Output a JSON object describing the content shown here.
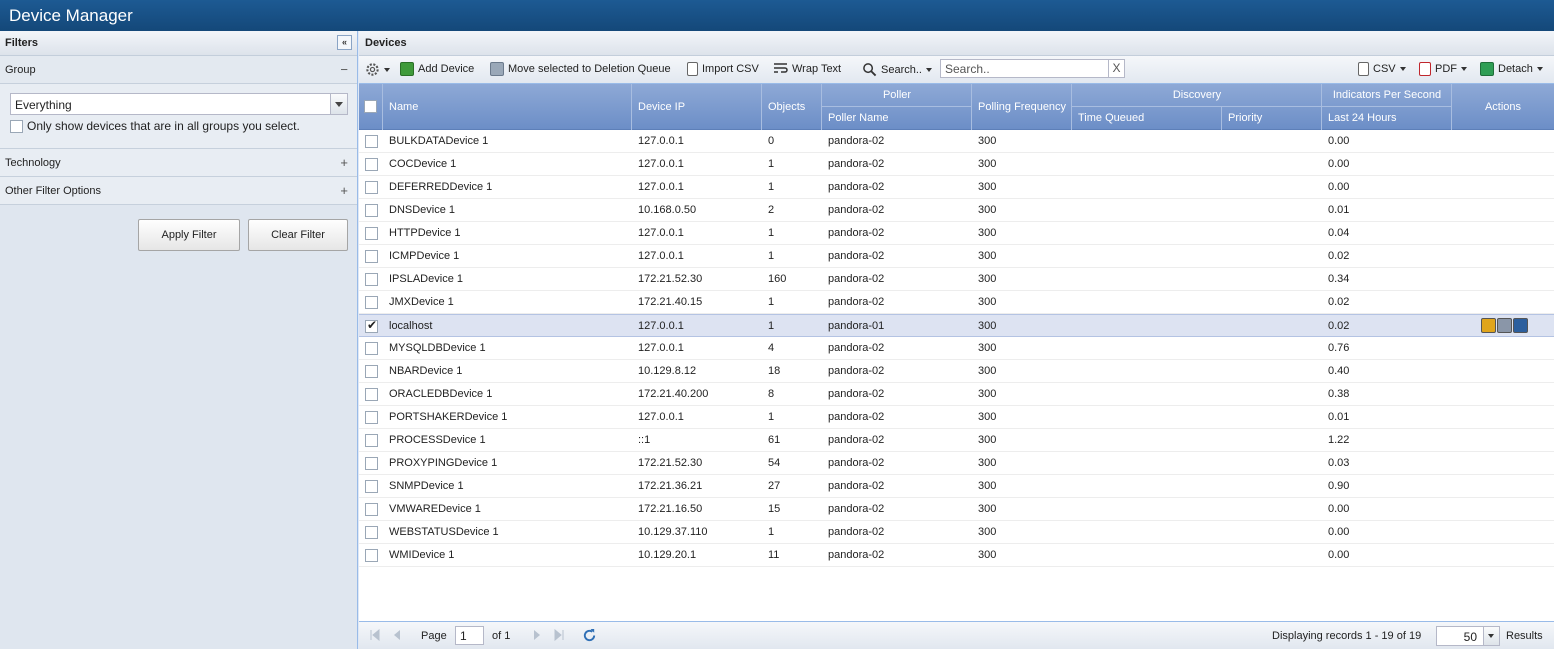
{
  "app": {
    "title": "Device Manager"
  },
  "filters": {
    "title": "Filters",
    "collapse_glyph": "«",
    "group": {
      "label": "Group",
      "toggle": "−",
      "value": "Everything",
      "only_all_label": "Only show devices that are in all groups you select."
    },
    "technology": {
      "label": "Technology",
      "toggle": "+"
    },
    "other": {
      "label": "Other Filter Options",
      "toggle": "+"
    },
    "apply_label": "Apply Filter",
    "clear_label": "Clear Filter"
  },
  "devices": {
    "title": "Devices",
    "toolbar": {
      "add_device": "Add Device",
      "move_deletion": "Move selected to Deletion Queue",
      "import_csv": "Import CSV",
      "wrap_text": "Wrap Text",
      "search_menu": "Search..",
      "search_placeholder": "Search..",
      "search_clear": "X",
      "csv": "CSV",
      "pdf": "PDF",
      "detach": "Detach"
    },
    "columns": {
      "name": "Name",
      "device_ip": "Device IP",
      "objects": "Objects",
      "poller": "Poller",
      "poller_name": "Poller Name",
      "polling_frequency": "Polling Frequency",
      "discovery": "Discovery",
      "time_queued": "Time Queued",
      "priority": "Priority",
      "ips": "Indicators Per Second",
      "last24": "Last 24 Hours",
      "actions": "Actions"
    },
    "rows": [
      {
        "name": "BULKDATADevice 1",
        "ip": "127.0.0.1",
        "objects": "0",
        "poller": "pandora-02",
        "freq": "300",
        "ips": "0.00",
        "selected": false
      },
      {
        "name": "COCDevice 1",
        "ip": "127.0.0.1",
        "objects": "1",
        "poller": "pandora-02",
        "freq": "300",
        "ips": "0.00",
        "selected": false
      },
      {
        "name": "DEFERREDDevice 1",
        "ip": "127.0.0.1",
        "objects": "1",
        "poller": "pandora-02",
        "freq": "300",
        "ips": "0.00",
        "selected": false
      },
      {
        "name": "DNSDevice 1",
        "ip": "10.168.0.50",
        "objects": "2",
        "poller": "pandora-02",
        "freq": "300",
        "ips": "0.01",
        "selected": false
      },
      {
        "name": "HTTPDevice 1",
        "ip": "127.0.0.1",
        "objects": "1",
        "poller": "pandora-02",
        "freq": "300",
        "ips": "0.04",
        "selected": false
      },
      {
        "name": "ICMPDevice 1",
        "ip": "127.0.0.1",
        "objects": "1",
        "poller": "pandora-02",
        "freq": "300",
        "ips": "0.02",
        "selected": false
      },
      {
        "name": "IPSLADevice 1",
        "ip": "172.21.52.30",
        "objects": "160",
        "poller": "pandora-02",
        "freq": "300",
        "ips": "0.34",
        "selected": false
      },
      {
        "name": "JMXDevice 1",
        "ip": "172.21.40.15",
        "objects": "1",
        "poller": "pandora-02",
        "freq": "300",
        "ips": "0.02",
        "selected": false
      },
      {
        "name": "localhost",
        "ip": "127.0.0.1",
        "objects": "1",
        "poller": "pandora-01",
        "freq": "300",
        "ips": "0.02",
        "selected": true
      },
      {
        "name": "MYSQLDBDevice 1",
        "ip": "127.0.0.1",
        "objects": "4",
        "poller": "pandora-02",
        "freq": "300",
        "ips": "0.76",
        "selected": false
      },
      {
        "name": "NBARDevice 1",
        "ip": "10.129.8.12",
        "objects": "18",
        "poller": "pandora-02",
        "freq": "300",
        "ips": "0.40",
        "selected": false
      },
      {
        "name": "ORACLEDBDevice 1",
        "ip": "172.21.40.200",
        "objects": "8",
        "poller": "pandora-02",
        "freq": "300",
        "ips": "0.38",
        "selected": false
      },
      {
        "name": "PORTSHAKERDevice 1",
        "ip": "127.0.0.1",
        "objects": "1",
        "poller": "pandora-02",
        "freq": "300",
        "ips": "0.01",
        "selected": false
      },
      {
        "name": "PROCESSDevice 1",
        "ip": "::1",
        "objects": "61",
        "poller": "pandora-02",
        "freq": "300",
        "ips": "1.22",
        "selected": false
      },
      {
        "name": "PROXYPINGDevice 1",
        "ip": "172.21.52.30",
        "objects": "54",
        "poller": "pandora-02",
        "freq": "300",
        "ips": "0.03",
        "selected": false
      },
      {
        "name": "SNMPDevice 1",
        "ip": "172.21.36.21",
        "objects": "27",
        "poller": "pandora-02",
        "freq": "300",
        "ips": "0.90",
        "selected": false
      },
      {
        "name": "VMWAREDevice 1",
        "ip": "172.21.16.50",
        "objects": "15",
        "poller": "pandora-02",
        "freq": "300",
        "ips": "0.00",
        "selected": false
      },
      {
        "name": "WEBSTATUSDevice 1",
        "ip": "10.129.37.110",
        "objects": "1",
        "poller": "pandora-02",
        "freq": "300",
        "ips": "0.00",
        "selected": false
      },
      {
        "name": "WMIDevice 1",
        "ip": "10.129.20.1",
        "objects": "11",
        "poller": "pandora-02",
        "freq": "300",
        "ips": "0.00",
        "selected": false
      }
    ],
    "pager": {
      "page_label": "Page",
      "page_value": "1",
      "of_label": "of 1",
      "displaying": "Displaying records 1 - 19 of 19",
      "page_size": "50",
      "results_label": "Results"
    }
  },
  "icons": {
    "collapse": "double-chevron-left-icon",
    "settings": "gear-icon",
    "add_device": "add-device-icon",
    "move_deletion": "deletion-queue-icon",
    "import_csv": "import-csv-icon",
    "wrap_text": "wrap-text-icon",
    "search": "magnifier-icon",
    "csv": "csv-icon",
    "pdf": "pdf-icon",
    "detach": "detach-icon",
    "actions": [
      "edit-icon",
      "wrench-icon",
      "details-icon"
    ],
    "pager": [
      "first-page-icon",
      "prev-page-icon",
      "next-page-icon",
      "last-page-icon",
      "refresh-icon"
    ]
  },
  "colors": {
    "titlebar": "#144879",
    "grid_header": "#7b9bd0",
    "selected_row": "#dde3f2"
  }
}
